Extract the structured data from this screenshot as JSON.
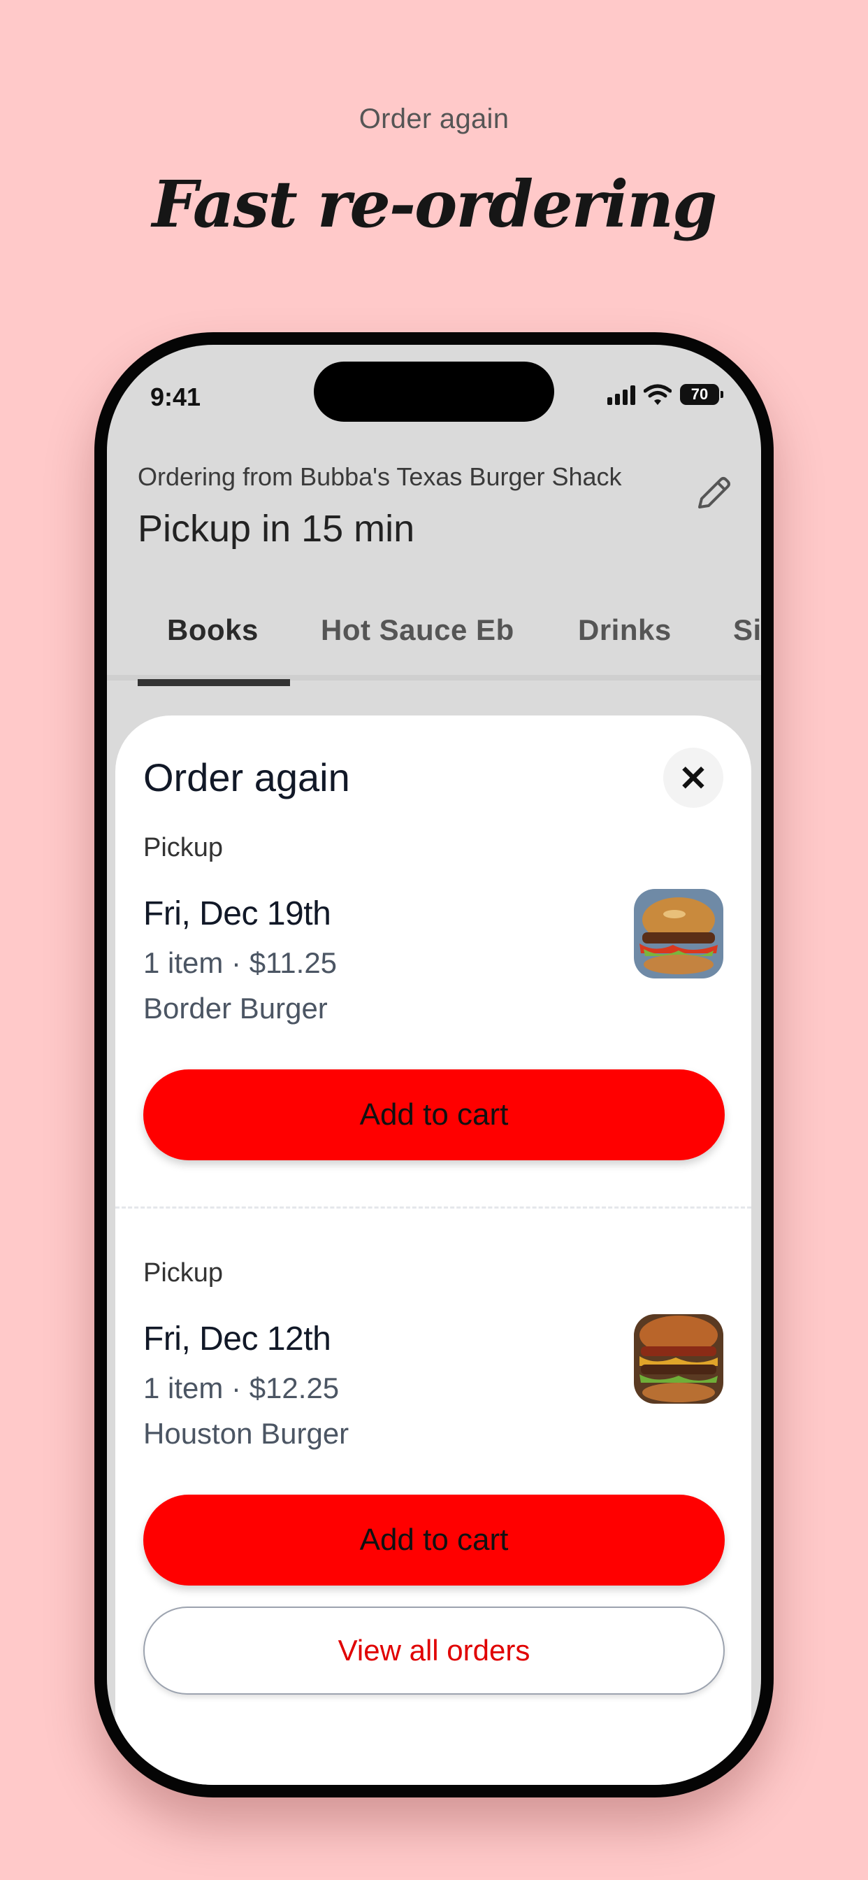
{
  "promo": {
    "subtitle": "Order again",
    "title": "Fast re-ordering"
  },
  "status_bar": {
    "time": "9:41",
    "battery": "70",
    "icons": [
      "cellular-signal-icon",
      "wifi-icon",
      "battery-icon"
    ]
  },
  "header": {
    "ordering_from": "Ordering from Bubba's Texas Burger Shack",
    "pickup": "Pickup in 15 min",
    "edit_icon": "pencil-icon"
  },
  "tabs": [
    {
      "label": "Books",
      "active": true
    },
    {
      "label": "Hot Sauce Eb",
      "active": false
    },
    {
      "label": "Drinks",
      "active": false
    },
    {
      "label": "Si",
      "active": false
    }
  ],
  "sheet": {
    "title": "Order again",
    "close_icon": "close-icon",
    "orders": [
      {
        "type": "Pickup",
        "date": "Fri, Dec 19th",
        "summary": "1 item · $11.25",
        "name": "Border Burger",
        "button": "Add to cart"
      },
      {
        "type": "Pickup",
        "date": "Fri, Dec 12th",
        "summary": "1 item · $12.25",
        "name": "Houston Burger",
        "button": "Add to cart"
      }
    ],
    "view_all": "View all orders"
  },
  "colors": {
    "background": "#ffc9c9",
    "primary": "#ff0000",
    "link": "#e00000"
  }
}
